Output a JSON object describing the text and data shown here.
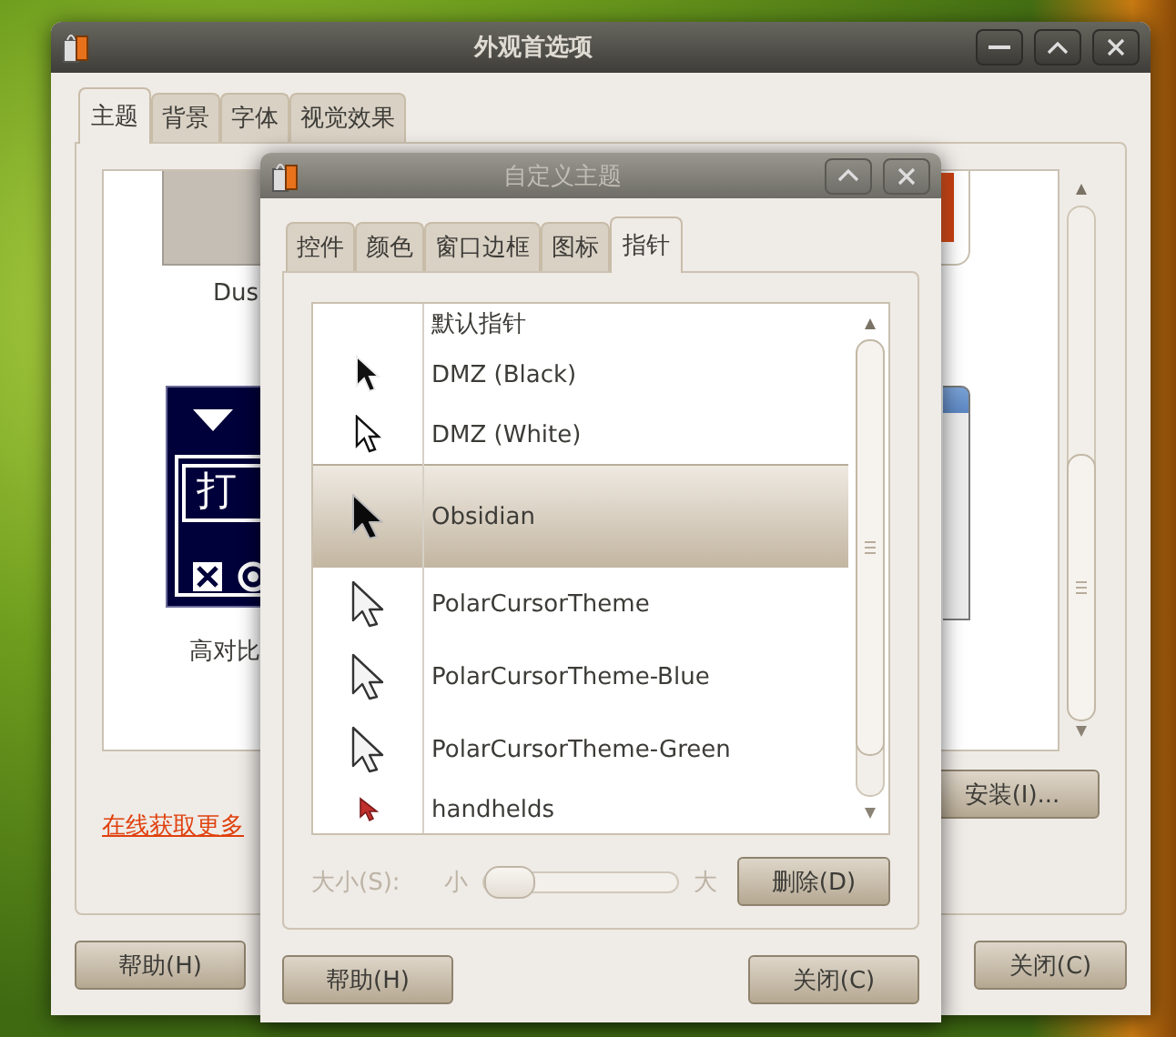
{
  "main_window": {
    "title": "外观首选项",
    "tabs": [
      {
        "label": "主题",
        "selected": true
      },
      {
        "label": "背景",
        "selected": false
      },
      {
        "label": "字体",
        "selected": false
      },
      {
        "label": "视觉效果",
        "selected": false
      }
    ],
    "gallery": {
      "items": [
        {
          "kind": "dust",
          "label": "Dus"
        },
        {
          "kind": "contrast",
          "label": "高对比",
          "preview_text": "打"
        }
      ]
    },
    "link": "在线获取更多",
    "install_button": "安装(I)...",
    "buttons": [
      "帮助(H)",
      "关闭(C)"
    ]
  },
  "dialog": {
    "title": "自定义主题",
    "tabs": [
      {
        "label": "控件",
        "selected": false
      },
      {
        "label": "颜色",
        "selected": false
      },
      {
        "label": "窗口边框",
        "selected": false
      },
      {
        "label": "图标",
        "selected": false
      },
      {
        "label": "指针",
        "selected": true
      }
    ],
    "cursors": [
      {
        "name": "默认指针",
        "kind": "none",
        "selected": false
      },
      {
        "name": "DMZ (Black)",
        "kind": "dmz-black",
        "selected": false
      },
      {
        "name": "DMZ (White)",
        "kind": "dmz-white",
        "selected": false
      },
      {
        "name": "Obsidian",
        "kind": "obsidian",
        "selected": true
      },
      {
        "name": "PolarCursorTheme",
        "kind": "polar",
        "selected": false
      },
      {
        "name": "PolarCursorTheme-Blue",
        "kind": "polar",
        "selected": false
      },
      {
        "name": "PolarCursorTheme-Green",
        "kind": "polar",
        "selected": false
      },
      {
        "name": "handhelds",
        "kind": "red",
        "selected": false
      }
    ],
    "size": {
      "label": "大小(S):",
      "min_label": "小",
      "max_label": "大",
      "level": 0,
      "disabled": true
    },
    "delete_button": "删除(D)",
    "buttons": [
      "帮助(H)",
      "关闭(C)"
    ]
  }
}
